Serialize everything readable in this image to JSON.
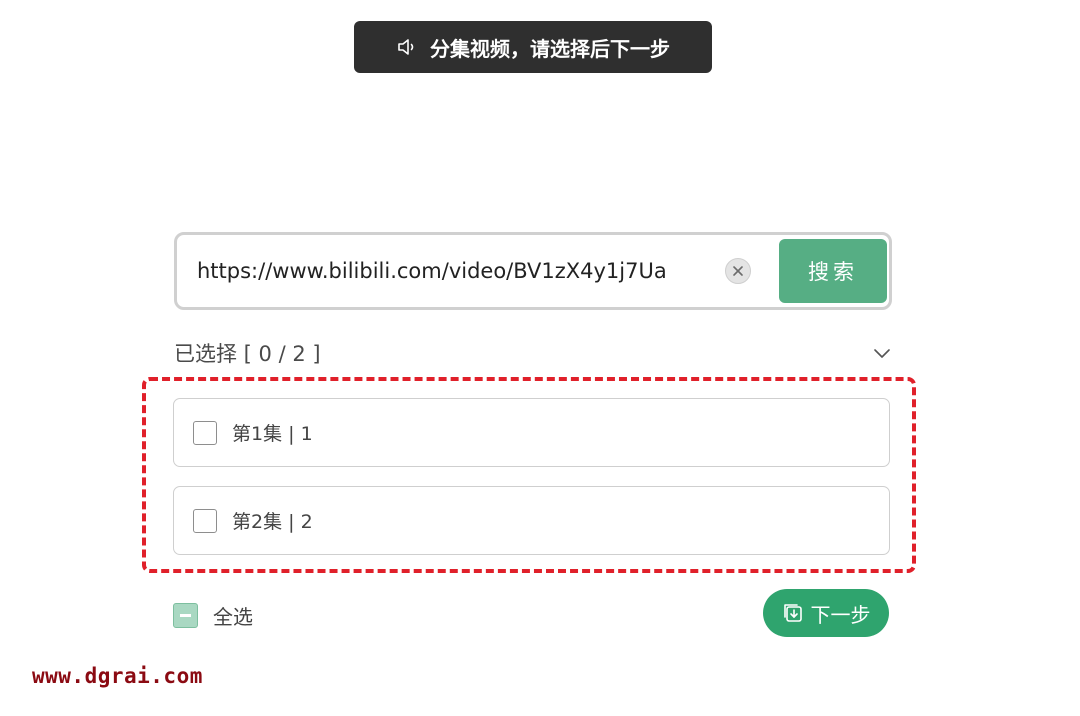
{
  "toast": {
    "icon": "speaker-icon",
    "message": "分集视频，请选择后下一步"
  },
  "search": {
    "value": "https://www.bilibili.com/video/BV1zX4y1j7Ua",
    "clear_icon": "close-circle-icon",
    "button_label": "搜索"
  },
  "selection": {
    "summary": "已选择 [ 0 / 2 ]",
    "selected_count": 0,
    "total_count": 2,
    "toggle_icon": "chevron-down-icon"
  },
  "episodes": [
    {
      "label": "第1集 | 1",
      "checked": false
    },
    {
      "label": "第2集 | 2",
      "checked": false
    }
  ],
  "footer": {
    "select_all_label": "全选",
    "next_label": "下一步",
    "next_icon": "download-box-icon"
  },
  "watermark": "www.dgrai.com",
  "colors": {
    "accent": "#56ae84",
    "next_button": "#2fa46e",
    "highlight": "#e0202a",
    "toast_bg": "#2f2f2f"
  }
}
